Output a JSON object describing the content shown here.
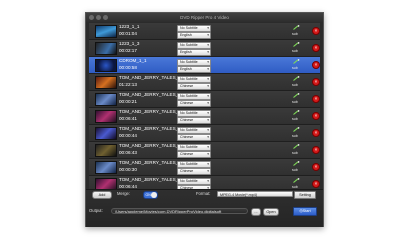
{
  "window": {
    "title": "DVD Ripper Pro 4 Video"
  },
  "rows": [
    {
      "name": "1223_1_1",
      "duration": "00:01:04",
      "subtitle": "No Subtitle",
      "audio": "English",
      "sub_label": "sub"
    },
    {
      "name": "1223_1_3",
      "duration": "00:02:17",
      "subtitle": "No Subtitle",
      "audio": "English",
      "sub_label": "sub"
    },
    {
      "name": "CDROM_1_1",
      "duration": "00:00:58",
      "subtitle": "No Subtitle",
      "audio": "English",
      "sub_label": "sub"
    },
    {
      "name": "TOM_AND_JERRY_TALES_VOL",
      "duration": "01:22:13",
      "subtitle": "No Subtitle",
      "audio": "Chinese",
      "sub_label": "sub"
    },
    {
      "name": "TOM_AND_JERRY_TALES_VOL",
      "duration": "00:00:21",
      "subtitle": "No Subtitle",
      "audio": "Chinese",
      "sub_label": "sub"
    },
    {
      "name": "TOM_AND_JERRY_TALES_VOL",
      "duration": "00:06:41",
      "subtitle": "No Subtitle",
      "audio": "Chinese",
      "sub_label": "sub"
    },
    {
      "name": "TOM_AND_JERRY_TALES_VOL",
      "duration": "00:00:44",
      "subtitle": "No Subtitle",
      "audio": "Chinese",
      "sub_label": "sub"
    },
    {
      "name": "TOM_AND_JERRY_TALES_VOL",
      "duration": "00:06:43",
      "subtitle": "No Subtitle",
      "audio": "Chinese",
      "sub_label": "sub"
    },
    {
      "name": "TOM_AND_JERRY_TALES_VOL",
      "duration": "00:00:30",
      "subtitle": "No Subtitle",
      "audio": "Chinese",
      "sub_label": "sub"
    },
    {
      "name": "TOM_AND_JERRY_TALES_VOL",
      "duration": "00:06:44",
      "subtitle": "No Subtitle",
      "audio": "Chinese",
      "sub_label": "sub"
    }
  ],
  "selected_row": "CDROM_1_1",
  "controls": {
    "add_label": "Add",
    "merge_label": "Merge:",
    "merge_state": "ON",
    "format_label": "Format:",
    "format_value": "MPEG-4 Movie(*.mp4)",
    "setting_label": "Setting",
    "output_label": "Output:",
    "output_path": "/Users/appleme/Movies/com.DVDRipperProVideo.digitalsoft",
    "dots_label": "...",
    "open_label": "Open",
    "start_label": "Start"
  },
  "colors": {
    "selected_row": "#2f5cc4",
    "delete_button": "#d51a1a",
    "toggle_on": "#3a6fd6"
  }
}
